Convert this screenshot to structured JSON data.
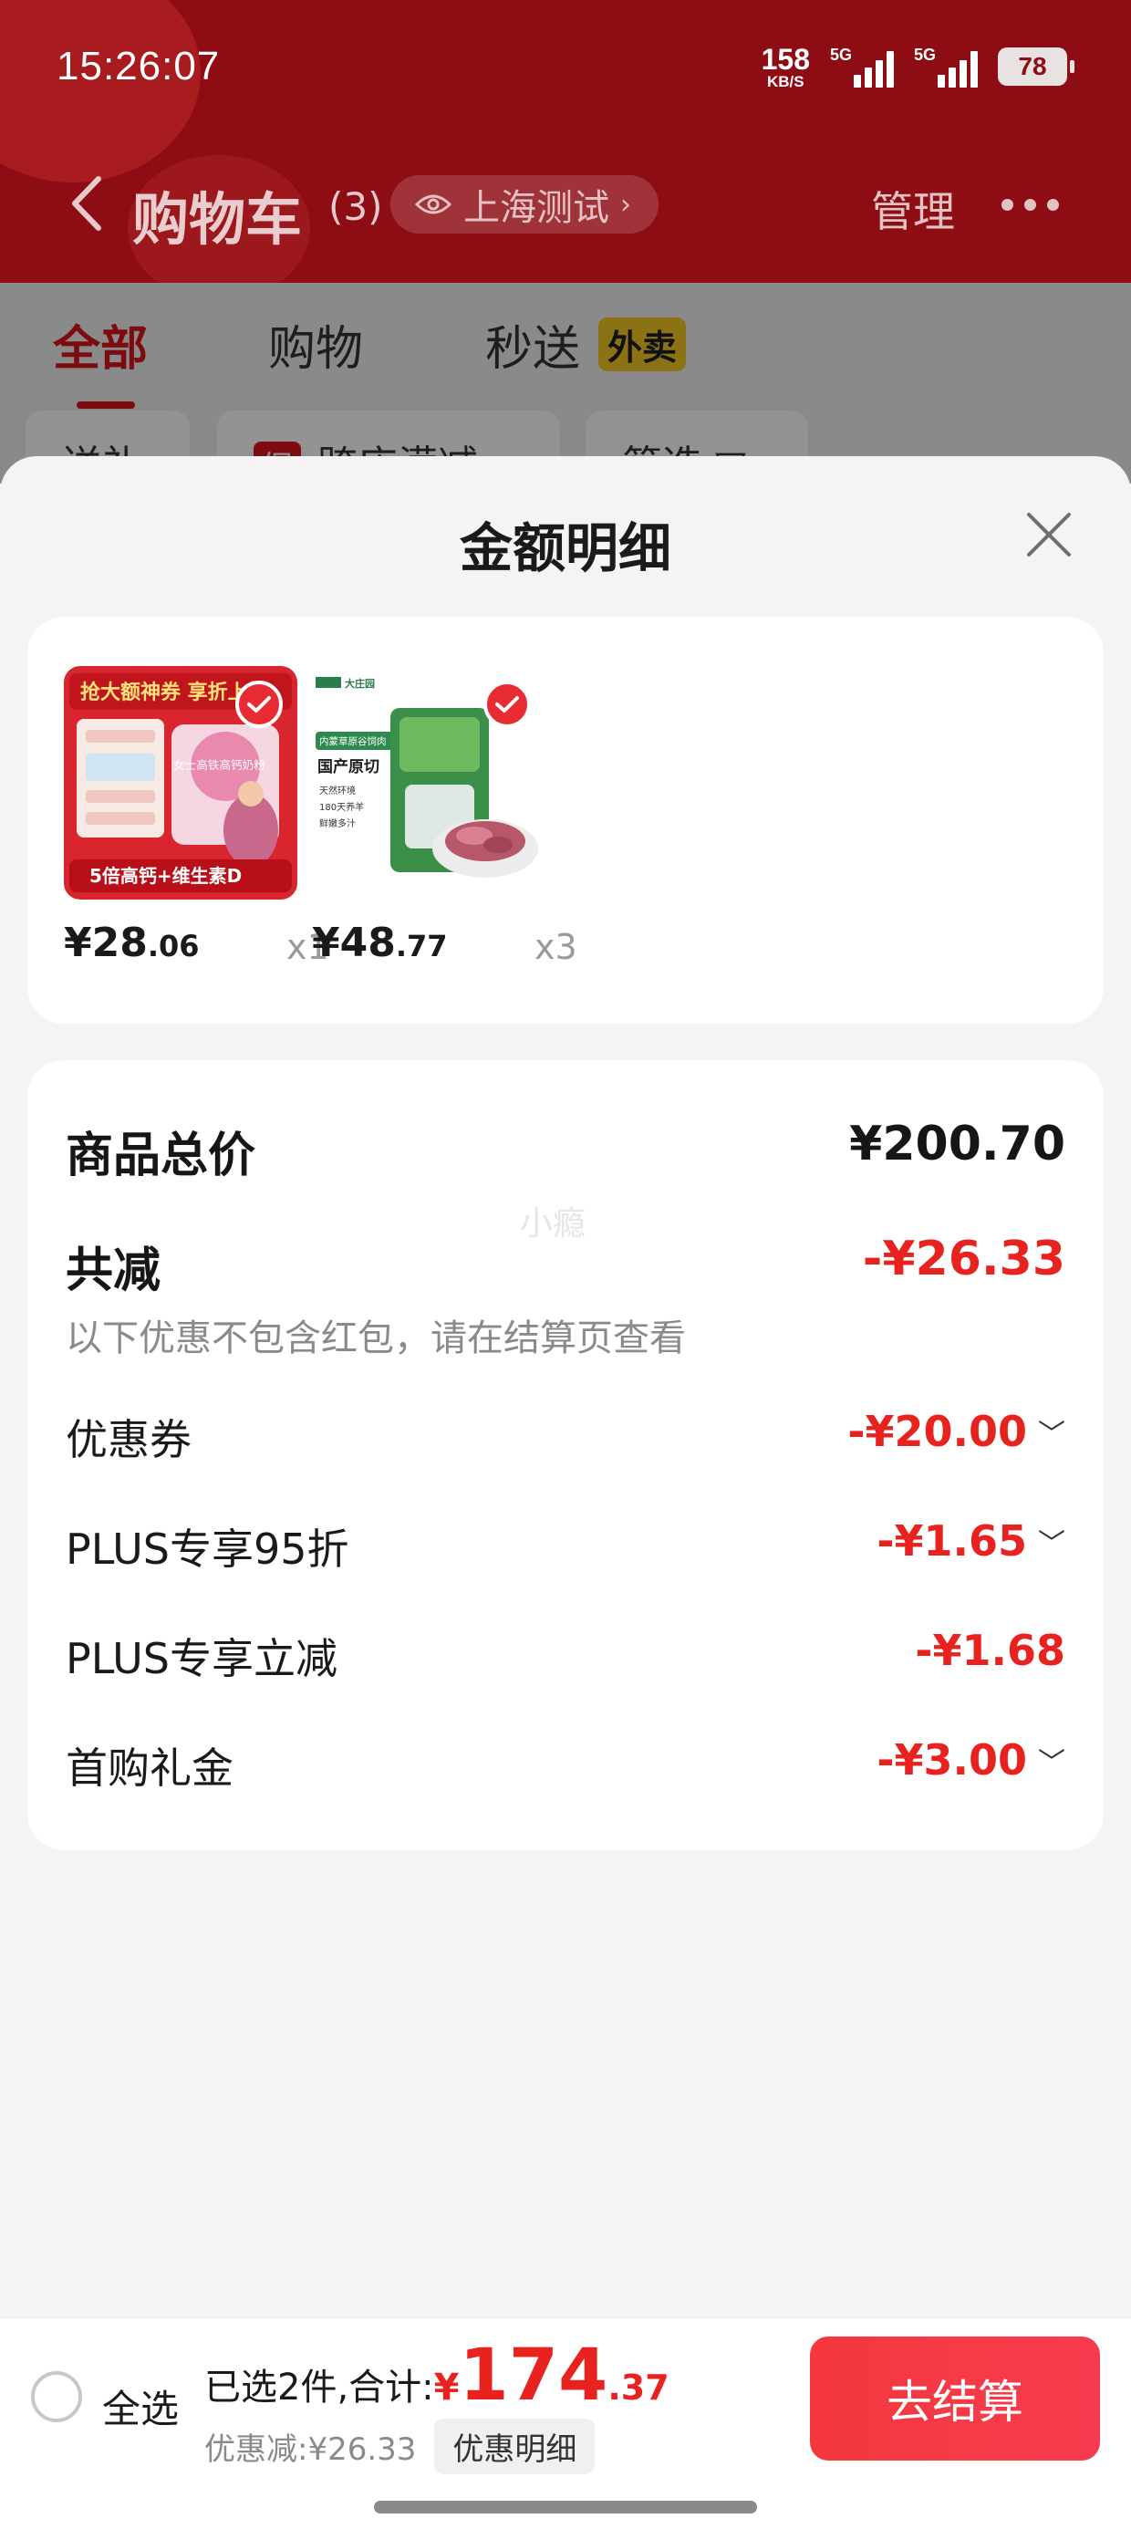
{
  "status_bar": {
    "time": "15:26:07",
    "net_speed": "158",
    "net_unit": "KB/S",
    "signal1_tag": "5G",
    "signal2_tag": "5G",
    "battery": "78"
  },
  "nav": {
    "title": "购物车",
    "count": "(3)",
    "location": "上海测试",
    "manage": "管理"
  },
  "tabs": [
    {
      "label": "全部",
      "active": true
    },
    {
      "label": "购物",
      "active": false
    },
    {
      "label": "秒送",
      "active": false
    }
  ],
  "tab_badge": "外卖",
  "filters": [
    "送礼",
    "跨店满减",
    "筛选"
  ],
  "filter_badge": "促",
  "sheet": {
    "title": "金额明细",
    "products": [
      {
        "price_int": "¥28",
        "price_dec": ".06",
        "qty": "x1",
        "image_text": {
          "banner": "抢大额神券 享折上折",
          "name": "女士高铁高钙奶粉",
          "footer": "5倍高钙+维生素D"
        }
      },
      {
        "price_int": "¥48",
        "price_dec": ".77",
        "qty": "x3",
        "image_text": {
          "brand": "大庄园",
          "tag": "内蒙草原谷饲肉",
          "headline": "国产原切",
          "points": [
            "天然环境",
            "180天养羊",
            "鲜嫩多汁"
          ]
        }
      }
    ],
    "summary": {
      "total_label": "商品总价",
      "total_value": "¥200.70",
      "watermark": "小瘾",
      "discount_label": "共减",
      "discount_value": "-¥26.33",
      "note": "以下优惠不包含红包，请在结算页查看",
      "items": [
        {
          "label": "优惠券",
          "value": "-¥20.00",
          "expandable": true
        },
        {
          "label": "PLUS专享95折",
          "value": "-¥1.65",
          "expandable": true
        },
        {
          "label": "PLUS专享立减",
          "value": "-¥1.68",
          "expandable": false
        },
        {
          "label": "首购礼金",
          "value": "-¥3.00",
          "expandable": true
        }
      ]
    }
  },
  "bottom": {
    "select_all": "全选",
    "selected_text": "已选2件,合计:",
    "currency": "¥",
    "total_int": "174",
    "total_dec": ".37",
    "discount_text": "优惠减:¥26.33",
    "detail_button": "优惠明细",
    "checkout": "去结算"
  },
  "colors": {
    "header_red": "#8e0d14",
    "accent_red": "#e8221f",
    "checkout_red": "#f4383d"
  }
}
